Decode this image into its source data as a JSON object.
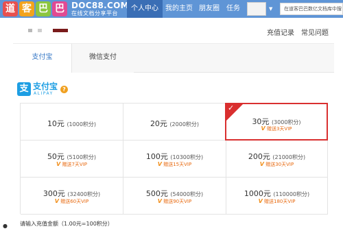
{
  "header": {
    "logo_chars": [
      "道",
      "客",
      "巴",
      "巴"
    ],
    "logo_colors": [
      "#e8504e",
      "#f3a31d",
      "#8cc63f",
      "#e14a92"
    ],
    "brand": "DOC88.COM",
    "brand_sub": "在线文档分享平台",
    "nav": [
      "个人中心",
      "我的主页",
      "朋友圈",
      "任务"
    ],
    "search_placeholder": "在道客巴巴数亿文档库中搜"
  },
  "subheader": {
    "links": [
      "充值记录",
      "常见问题"
    ]
  },
  "tabs": [
    "支付宝",
    "微信支付"
  ],
  "alipay": {
    "name": "支付宝",
    "sub": "ALIPAY",
    "icon_glyph": "支",
    "brand_color": "#1d9ee3"
  },
  "packages": [
    {
      "amount": "10元",
      "points": "(1000积分)",
      "gift": ""
    },
    {
      "amount": "20元",
      "points": "(2000积分)",
      "gift": ""
    },
    {
      "amount": "30元",
      "points": "(3000积分)",
      "gift": "赠送3天VIP",
      "selected": true
    },
    {
      "amount": "50元",
      "points": "(5100积分)",
      "gift": "赠送7天VIP"
    },
    {
      "amount": "100元",
      "points": "(10300积分)",
      "gift": "赠送15天VIP"
    },
    {
      "amount": "200元",
      "points": "(21000积分)",
      "gift": "赠送30天VIP"
    },
    {
      "amount": "300元",
      "points": "(32400积分)",
      "gift": "赠送60天VIP"
    },
    {
      "amount": "500元",
      "points": "(54000积分)",
      "gift": "赠送90天VIP"
    },
    {
      "amount": "1000元",
      "points": "(110000积分)",
      "gift": "赠送180天VIP"
    }
  ],
  "custom_amount_label": "请输入充值金额（1.00元=100积分）",
  "colors": {
    "topbar": "#5f95d6",
    "selected_border": "#d92f2f",
    "gift_text": "#e86a10",
    "tab_active": "#3778c6"
  }
}
